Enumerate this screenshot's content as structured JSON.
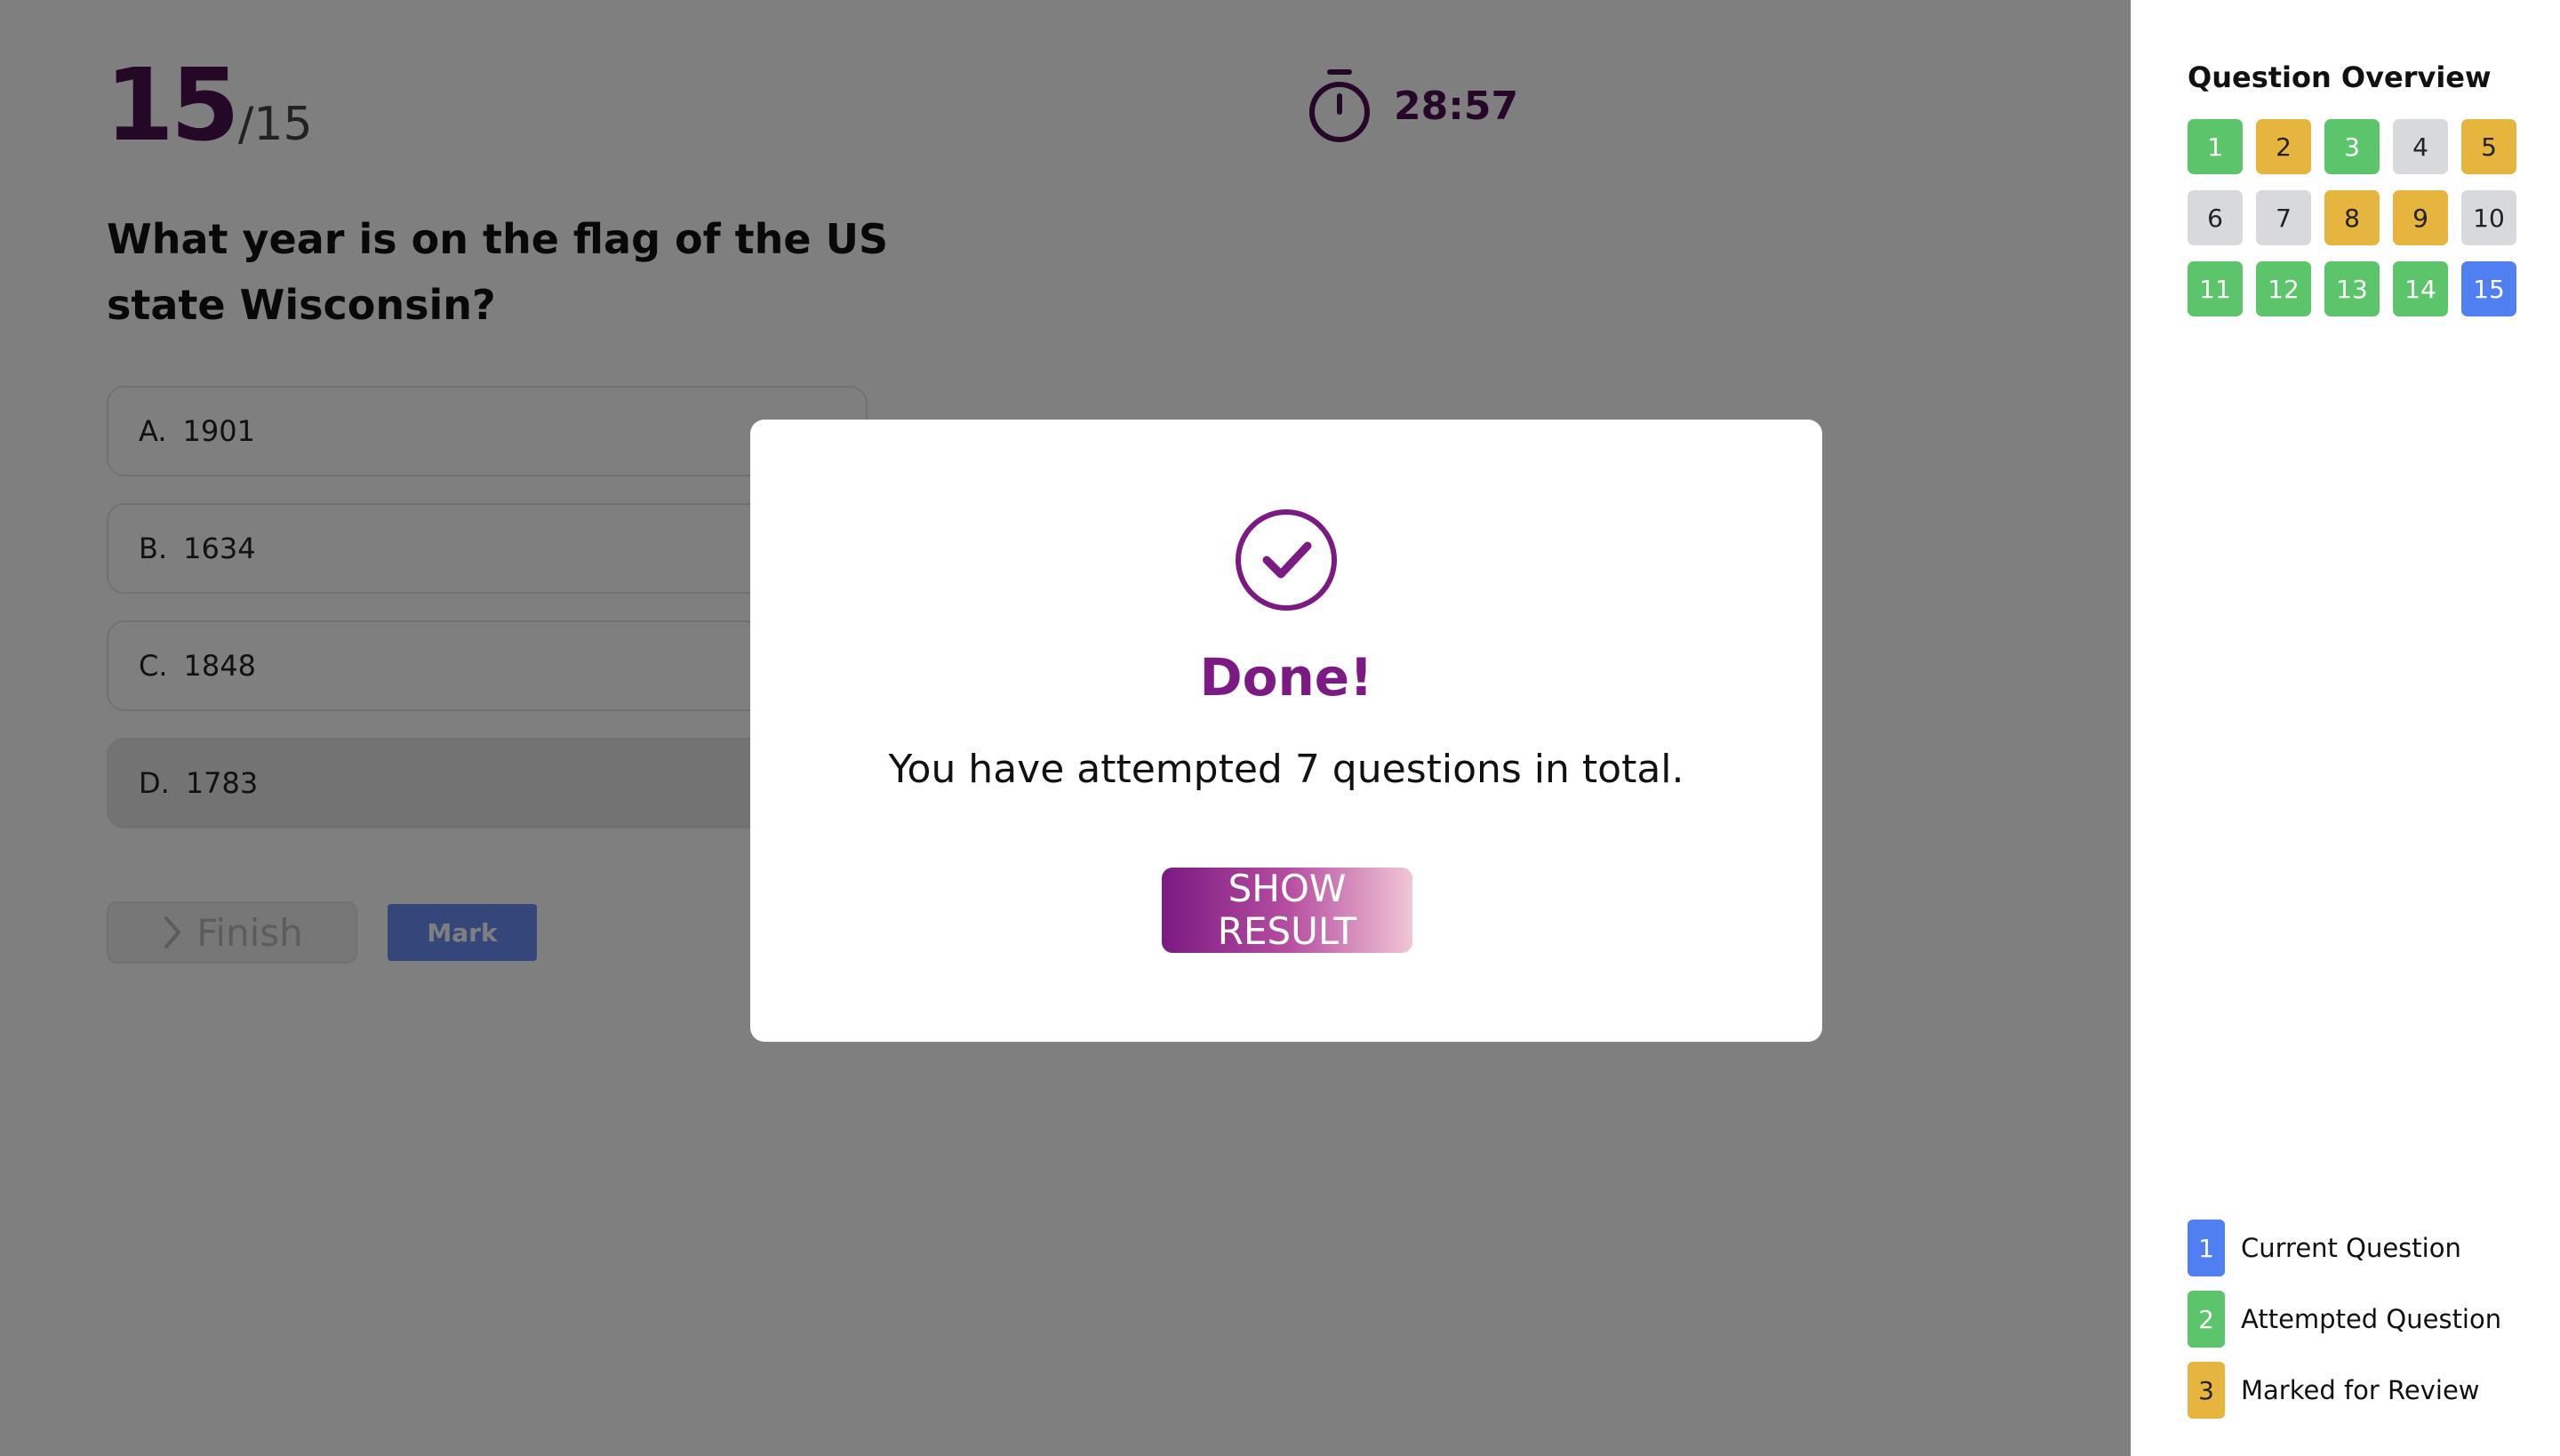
{
  "quiz": {
    "current_number": "15",
    "total": "/15",
    "timer": "28:57",
    "question": "What year is on the flag of the US state Wisconsin?",
    "options": [
      {
        "letter": "A.",
        "text": "1901",
        "selected": false
      },
      {
        "letter": "B.",
        "text": "1634",
        "selected": false
      },
      {
        "letter": "C.",
        "text": "1848",
        "selected": false
      },
      {
        "letter": "D.",
        "text": "1783",
        "selected": true
      }
    ],
    "finish_label": "Finish",
    "mark_label": "Mark"
  },
  "sidebar": {
    "title": "Question Overview",
    "questions": [
      {
        "n": "1",
        "status": "attempted"
      },
      {
        "n": "2",
        "status": "marked"
      },
      {
        "n": "3",
        "status": "attempted"
      },
      {
        "n": "4",
        "status": "unattempted"
      },
      {
        "n": "5",
        "status": "marked"
      },
      {
        "n": "6",
        "status": "unattempted"
      },
      {
        "n": "7",
        "status": "unattempted"
      },
      {
        "n": "8",
        "status": "marked"
      },
      {
        "n": "9",
        "status": "marked"
      },
      {
        "n": "10",
        "status": "unattempted"
      },
      {
        "n": "11",
        "status": "attempted"
      },
      {
        "n": "12",
        "status": "attempted"
      },
      {
        "n": "13",
        "status": "attempted"
      },
      {
        "n": "14",
        "status": "attempted"
      },
      {
        "n": "15",
        "status": "current"
      }
    ],
    "legend": [
      {
        "n": "1",
        "label": "Current Question",
        "status": "current"
      },
      {
        "n": "2",
        "label": "Attempted Question",
        "status": "attempted"
      },
      {
        "n": "3",
        "label": "Marked for Review",
        "status": "marked"
      }
    ]
  },
  "modal": {
    "heading": "Done!",
    "message": "You have attempted 7 questions in total.",
    "button_label": "SHOW RESULT"
  },
  "colors": {
    "brand_purple": "#7a1a82",
    "attempted": "#5cc46a",
    "marked": "#e5b53d",
    "current": "#4f7ff0",
    "unattempted": "#d7d9dc"
  },
  "icons": {
    "timer": "stopwatch-icon",
    "finish": "chevron-right-icon",
    "done": "check-circle-icon"
  }
}
